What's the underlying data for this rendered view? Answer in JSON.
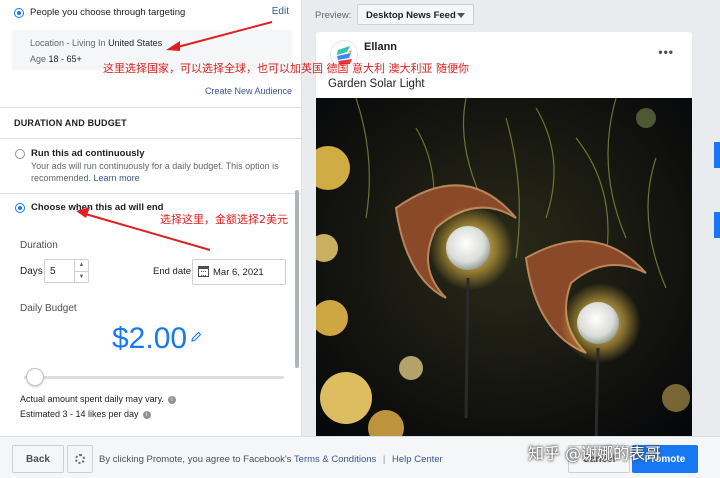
{
  "targeting": {
    "option_label": "People you choose through targeting",
    "edit_label": "Edit",
    "location_prefix": "Location - Living In",
    "location_value": "United States",
    "age_prefix": "Age",
    "age_value": "18 - 65+",
    "create_audience": "Create New Audience"
  },
  "duration_budget": {
    "section_title": "DURATION AND BUDGET",
    "continuous_title": "Run this ad continuously",
    "continuous_desc": "Your ads will run continuously for a daily budget. This option is recommended.",
    "learn_more": "Learn more",
    "end_title": "Choose when this ad will end",
    "duration_label": "Duration",
    "days_label": "Days",
    "days_value": "5",
    "end_date_label": "End date",
    "end_date_value": "Mar 6, 2021",
    "daily_budget_label": "Daily Budget",
    "budget_amount": "$2.00",
    "slider_level_fraction": 0.0,
    "note_1": "Actual amount spent daily may vary.",
    "note_2": "Estimated 3 - 14 likes per day"
  },
  "preview": {
    "label": "Preview:",
    "placement": "Desktop News Feed",
    "page_name": "Ellann",
    "post_text": "Garden Solar Light",
    "more_icon": "ellipsis-icon"
  },
  "footer": {
    "back": "Back",
    "agree_text": "By clicking Promote, you agree to Facebook's",
    "terms": "Terms & Conditions",
    "separator": "|",
    "help": "Help Center",
    "cancel": "Cancel",
    "promote": "Promote"
  },
  "annotations": {
    "country_note": "这里选择国家，可以选择全球，也可以加英国 德国 意大利 澳大利亚 随便你",
    "end_note": "选择这里，金额选择2美元"
  },
  "watermark": "知乎 @谢娜的表哥",
  "colors": {
    "accent": "#1877f2",
    "annotation": "#e02020",
    "link": "#385898"
  }
}
